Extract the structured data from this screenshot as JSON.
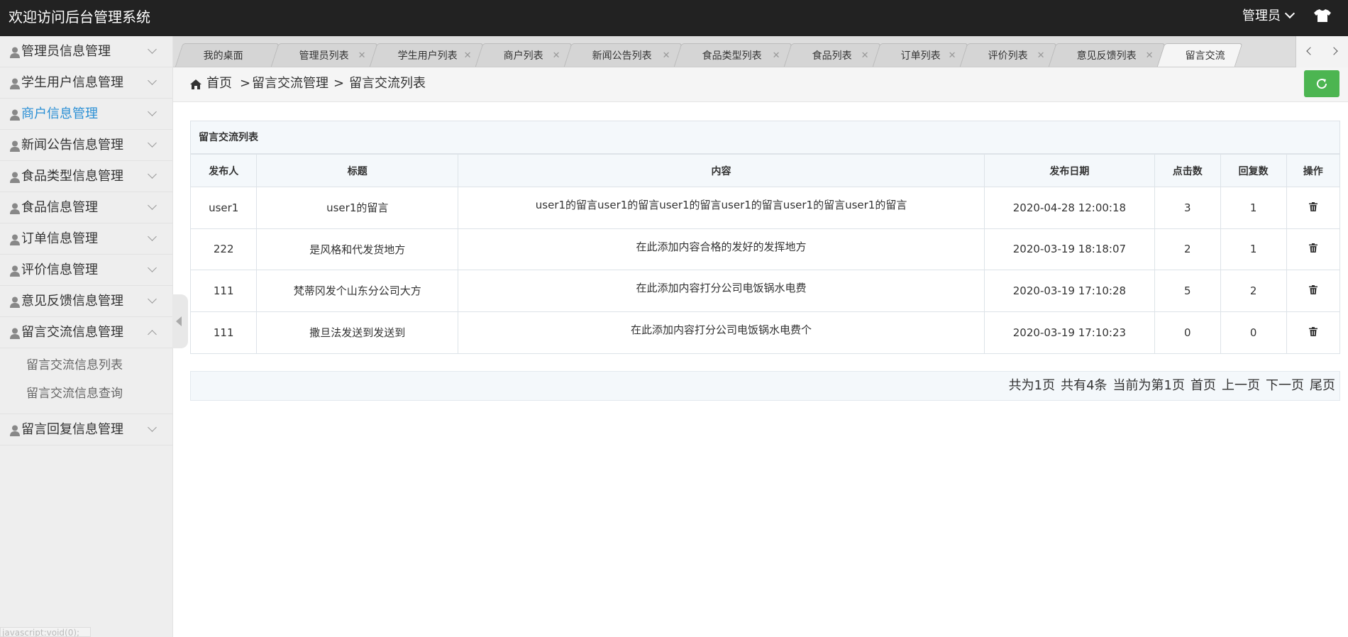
{
  "header": {
    "title": "欢迎访问后台管理系统",
    "user_label": "管理员"
  },
  "sidebar": {
    "items": [
      {
        "label": "管理员信息管理",
        "expanded": false,
        "active": false
      },
      {
        "label": "学生用户信息管理",
        "expanded": false,
        "active": false
      },
      {
        "label": "商户信息管理",
        "expanded": false,
        "active": true
      },
      {
        "label": "新闻公告信息管理",
        "expanded": false,
        "active": false
      },
      {
        "label": "食品类型信息管理",
        "expanded": false,
        "active": false
      },
      {
        "label": "食品信息管理",
        "expanded": false,
        "active": false
      },
      {
        "label": "订单信息管理",
        "expanded": false,
        "active": false
      },
      {
        "label": "评价信息管理",
        "expanded": false,
        "active": false
      },
      {
        "label": "意见反馈信息管理",
        "expanded": false,
        "active": false
      },
      {
        "label": "留言交流信息管理",
        "expanded": true,
        "active": false
      },
      {
        "label": "留言回复信息管理",
        "expanded": false,
        "active": false
      }
    ],
    "submenu": [
      "留言交流信息列表",
      "留言交流信息查询"
    ],
    "status_text": "javascript:void(0);"
  },
  "tabs": [
    {
      "label": "我的桌面",
      "closable": false
    },
    {
      "label": "管理员列表",
      "closable": true
    },
    {
      "label": "学生用户列表",
      "closable": true
    },
    {
      "label": "商户列表",
      "closable": true
    },
    {
      "label": "新闻公告列表",
      "closable": true
    },
    {
      "label": "食品类型列表",
      "closable": true
    },
    {
      "label": "食品列表",
      "closable": true
    },
    {
      "label": "订单列表",
      "closable": true
    },
    {
      "label": "评价列表",
      "closable": true
    },
    {
      "label": "意见反馈列表",
      "closable": true
    },
    {
      "label": "留言交流",
      "closable": false,
      "active": true
    }
  ],
  "breadcrumb": {
    "home": "首页",
    "level1": "留言交流管理",
    "level2": "留言交流列表",
    "sep": ">"
  },
  "panel": {
    "title": "留言交流列表",
    "columns": [
      "发布人",
      "标题",
      "内容",
      "发布日期",
      "点击数",
      "回复数",
      "操作"
    ],
    "rows": [
      {
        "author": "user1",
        "title": "user1的留言",
        "content": "user1的留言user1的留言user1的留言user1的留言user1的留言user1的留言",
        "date": "2020-04-28 12:00:18",
        "clicks": "3",
        "replies": "1"
      },
      {
        "author": "222",
        "title": "是风格和代发货地方",
        "content": "在此添加内容合格的发好的发挥地方",
        "date": "2020-03-19 18:18:07",
        "clicks": "2",
        "replies": "1"
      },
      {
        "author": "111",
        "title": "梵蒂冈发个山东分公司大方",
        "content": "在此添加内容打分公司电饭锅水电费",
        "date": "2020-03-19 17:10:28",
        "clicks": "5",
        "replies": "2"
      },
      {
        "author": "111",
        "title": "撒旦法发送到发送到",
        "content": "在此添加内容打分公司电饭锅水电费个",
        "date": "2020-03-19 17:10:23",
        "clicks": "0",
        "replies": "0"
      }
    ]
  },
  "pager": {
    "total_pages": "共为1页",
    "total_items": "共有4条",
    "current": "当前为第1页",
    "first": "首页",
    "prev": "上一页",
    "next": "下一页",
    "last": "尾页"
  },
  "colors": {
    "topbar": "#222222",
    "active_menu": "#2a8fd5",
    "refresh_button": "#4cb551"
  },
  "icons": {
    "user": "user-icon",
    "chevron": "chevron-down-icon",
    "home": "home-icon",
    "refresh": "refresh-icon",
    "delete": "trash-icon",
    "skin": "tshirt-icon"
  }
}
